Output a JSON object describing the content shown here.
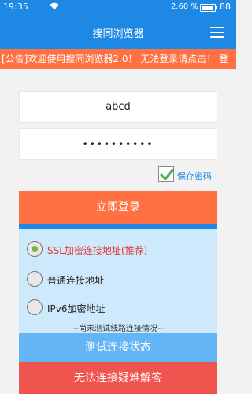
{
  "status_bar": {
    "time": "19:35",
    "battery_percent": "2.60 %",
    "battery_level": "88",
    "battery_fill_percent": 88
  },
  "app_bar": {
    "title": "搜同浏览器",
    "menu_icon": "hamburger-menu-icon"
  },
  "notice": {
    "text": "[公告]欢迎使用搜同浏览器2.0！ 无法登录请点击！ 登"
  },
  "login_form": {
    "username_value": "abcd",
    "password_value": "••••••••••",
    "remember_label": "保存密码",
    "remember_checked": true,
    "login_button": "立即登录"
  },
  "connection": {
    "options": [
      {
        "label": "SSL加密连接地址(推荐)",
        "selected": true
      },
      {
        "label": "普通连接地址",
        "selected": false
      },
      {
        "label": "IPv6加密地址",
        "selected": false
      }
    ],
    "hint": "--尚未测试线路连接情况--",
    "test_button": "测试连接状态",
    "help_button": "无法连接疑难解答"
  },
  "colors": {
    "primary": "#1e88e5",
    "accent": "#ff7043",
    "danger": "#f0544f",
    "panel": "#cde9fb",
    "selected_text": "#e53935",
    "radio_on": "#7cb342"
  }
}
